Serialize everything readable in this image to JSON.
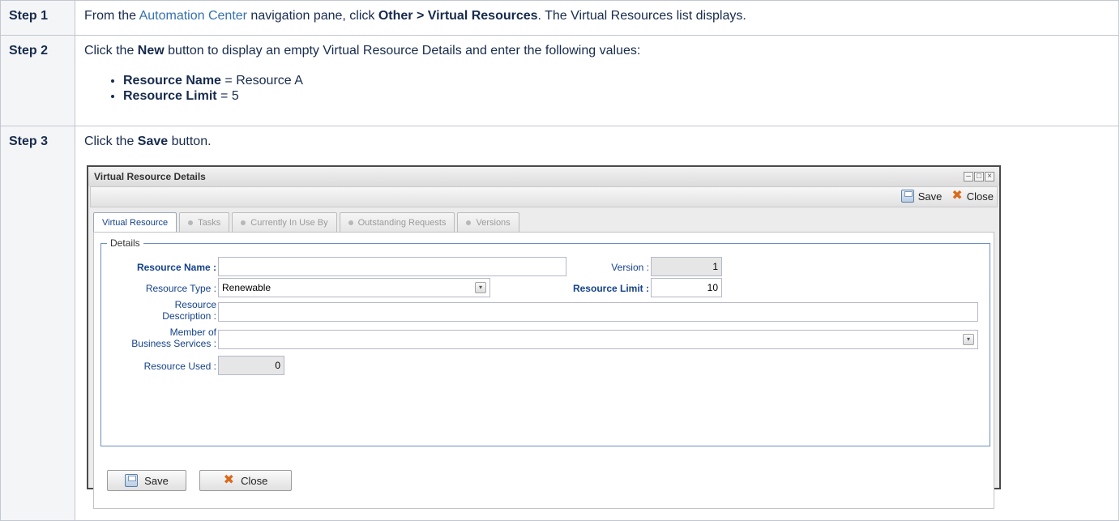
{
  "steps": [
    {
      "label": "Step 1",
      "text_pre": "From the ",
      "link": "Automation Center",
      "text_mid": " navigation pane, click ",
      "bold": "Other > Virtual Resources",
      "text_post": ". The Virtual Resources list displays."
    },
    {
      "label": "Step 2",
      "text_pre": "Click the ",
      "bold": "New",
      "text_post": " button to display an empty Virtual Resource Details and enter the following values:",
      "values": [
        {
          "name": "Resource Name",
          "value": " = Resource A"
        },
        {
          "name": "Resource Limit",
          "value": " = 5"
        }
      ]
    },
    {
      "label": "Step 3",
      "text_pre": "Click the ",
      "bold": "Save",
      "text_post": " button."
    }
  ],
  "window": {
    "title": "Virtual Resource Details",
    "controls": [
      "–",
      "□",
      "×"
    ],
    "toolbar": {
      "save": "Save",
      "close": "Close"
    },
    "tabs": [
      "Virtual Resource",
      "Tasks",
      "Currently In Use By",
      "Outstanding Requests",
      "Versions"
    ],
    "fieldset_legend": "Details",
    "fields": {
      "resource_name": {
        "label": "Resource Name :",
        "value": ""
      },
      "version": {
        "label": "Version :",
        "value": "1"
      },
      "resource_type": {
        "label": "Resource Type :",
        "value": "Renewable"
      },
      "resource_limit": {
        "label": "Resource Limit :",
        "value": "10"
      },
      "resource_description": {
        "label_line1": "Resource",
        "label_line2": "Description :",
        "value": ""
      },
      "member_of": {
        "label_line1": "Member of",
        "label_line2": "Business Services :",
        "value": ""
      },
      "resource_used": {
        "label": "Resource Used :",
        "value": "0"
      }
    },
    "buttons": {
      "save": "Save",
      "close": "Close"
    }
  },
  "icons": {
    "save": "save-icon",
    "close": "close-icon",
    "dropdown": "chevron-down-icon"
  },
  "colors": {
    "link": "#3572b0",
    "label": "#15428b",
    "fieldset_border": "#6b8fc0"
  }
}
